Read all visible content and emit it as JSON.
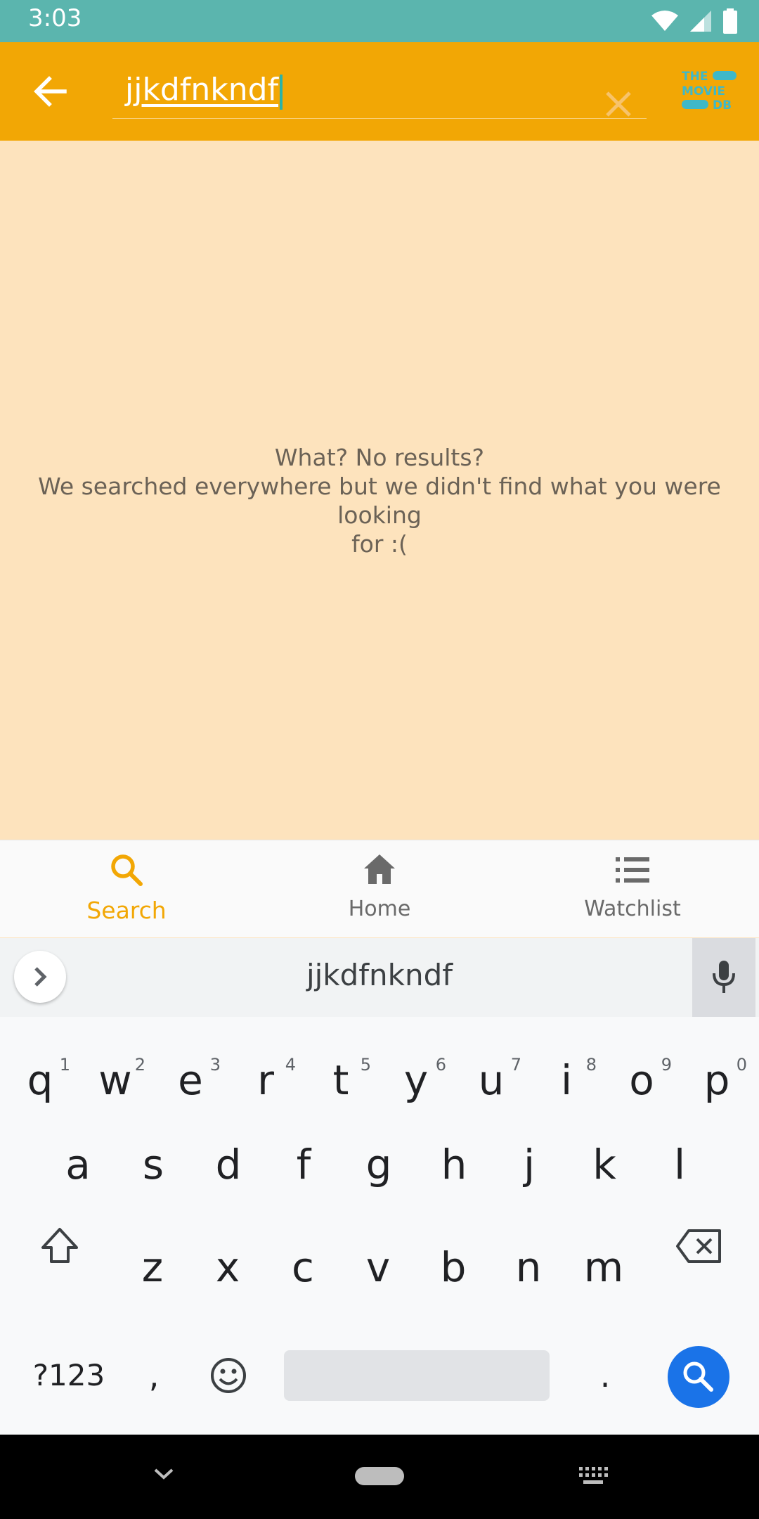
{
  "status_bar": {
    "time": "3:03"
  },
  "toolbar": {
    "query": "jjkdfnkndf",
    "logo_lines": [
      "THE",
      "MOVIE",
      "DB"
    ]
  },
  "empty_state": {
    "title": "What? No results?",
    "message_line1": "We searched everywhere but we didn't find what you were looking",
    "message_line2": "for :("
  },
  "bottom_nav": {
    "items": [
      {
        "label": "Search",
        "icon": "search-icon",
        "active": true
      },
      {
        "label": "Home",
        "icon": "home-icon",
        "active": false
      },
      {
        "label": "Watchlist",
        "icon": "list-icon",
        "active": false
      }
    ]
  },
  "keyboard": {
    "suggestion": "jjkdfnkndf",
    "row1": [
      {
        "k": "q",
        "n": "1"
      },
      {
        "k": "w",
        "n": "2"
      },
      {
        "k": "e",
        "n": "3"
      },
      {
        "k": "r",
        "n": "4"
      },
      {
        "k": "t",
        "n": "5"
      },
      {
        "k": "y",
        "n": "6"
      },
      {
        "k": "u",
        "n": "7"
      },
      {
        "k": "i",
        "n": "8"
      },
      {
        "k": "o",
        "n": "9"
      },
      {
        "k": "p",
        "n": "0"
      }
    ],
    "row2": [
      "a",
      "s",
      "d",
      "f",
      "g",
      "h",
      "j",
      "k",
      "l"
    ],
    "row3": [
      "z",
      "x",
      "c",
      "v",
      "b",
      "n",
      "m"
    ],
    "symbols_label": "?123",
    "comma": ",",
    "period": "."
  },
  "colors": {
    "accent": "#f2a705",
    "background": "#fde3bd",
    "status_bar": "#5bb5ae",
    "inactive_nav": "#6a6a6a",
    "keyboard_action": "#1a73e8"
  }
}
